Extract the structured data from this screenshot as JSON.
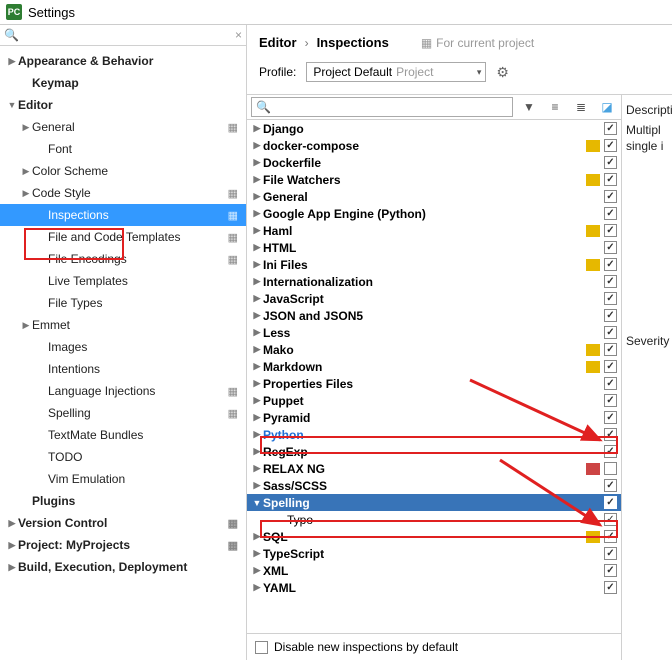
{
  "window": {
    "title": "Settings"
  },
  "search": {
    "placeholder": ""
  },
  "leftTree": {
    "items": [
      {
        "label": "Appearance & Behavior",
        "bold": true,
        "chev": "right",
        "indent": 0
      },
      {
        "label": "Keymap",
        "bold": true,
        "indent": 1
      },
      {
        "label": "Editor",
        "bold": true,
        "chev": "down",
        "indent": 0
      },
      {
        "label": "General",
        "indent": 1,
        "chev": "right",
        "copy": true
      },
      {
        "label": "Font",
        "indent": 2
      },
      {
        "label": "Color Scheme",
        "indent": 1,
        "chev": "right"
      },
      {
        "label": "Code Style",
        "indent": 1,
        "chev": "right",
        "copy": true
      },
      {
        "label": "Inspections",
        "indent": 2,
        "selected": true,
        "copy": true
      },
      {
        "label": "File and Code Templates",
        "indent": 2,
        "copy": true
      },
      {
        "label": "File Encodings",
        "indent": 2,
        "copy": true
      },
      {
        "label": "Live Templates",
        "indent": 2
      },
      {
        "label": "File Types",
        "indent": 2
      },
      {
        "label": "Emmet",
        "indent": 1,
        "chev": "right"
      },
      {
        "label": "Images",
        "indent": 2
      },
      {
        "label": "Intentions",
        "indent": 2
      },
      {
        "label": "Language Injections",
        "indent": 2,
        "copy": true
      },
      {
        "label": "Spelling",
        "indent": 2,
        "copy": true
      },
      {
        "label": "TextMate Bundles",
        "indent": 2
      },
      {
        "label": "TODO",
        "indent": 2
      },
      {
        "label": "Vim Emulation",
        "indent": 2
      },
      {
        "label": "Plugins",
        "bold": true,
        "indent": 1
      },
      {
        "label": "Version Control",
        "bold": true,
        "chev": "right",
        "indent": 0,
        "copy": true
      },
      {
        "label": "Project: MyProjects",
        "bold": true,
        "chev": "right",
        "indent": 0,
        "copy": true
      },
      {
        "label": "Build, Execution, Deployment",
        "bold": true,
        "chev": "right",
        "indent": 0
      }
    ]
  },
  "breadcrumb": {
    "a": "Editor",
    "b": "Inspections",
    "for_project": "For current project"
  },
  "profile": {
    "label": "Profile:",
    "value": "Project Default",
    "suffix": "Project"
  },
  "inspections": [
    {
      "label": "Django",
      "color": "",
      "checked": true
    },
    {
      "label": "docker-compose",
      "color": "#e6b800",
      "checked": true
    },
    {
      "label": "Dockerfile",
      "color": "",
      "checked": true
    },
    {
      "label": "File Watchers",
      "color": "#e6b800",
      "checked": true
    },
    {
      "label": "General",
      "color": "",
      "checked": true
    },
    {
      "label": "Google App Engine (Python)",
      "color": "",
      "checked": true
    },
    {
      "label": "Haml",
      "color": "#e6b800",
      "checked": true
    },
    {
      "label": "HTML",
      "color": "",
      "checked": true
    },
    {
      "label": "Ini Files",
      "color": "#e6b800",
      "checked": true
    },
    {
      "label": "Internationalization",
      "color": "",
      "checked": true
    },
    {
      "label": "JavaScript",
      "color": "",
      "checked": true
    },
    {
      "label": "JSON and JSON5",
      "color": "",
      "checked": true
    },
    {
      "label": "Less",
      "color": "",
      "checked": true
    },
    {
      "label": "Mako",
      "color": "#e6b800",
      "checked": true
    },
    {
      "label": "Markdown",
      "color": "#e6b800",
      "checked": true
    },
    {
      "label": "Properties Files",
      "color": "",
      "checked": true
    },
    {
      "label": "Puppet",
      "color": "",
      "checked": true
    },
    {
      "label": "Pyramid",
      "color": "",
      "checked": true
    },
    {
      "label": "Python",
      "color": "",
      "checked": true,
      "hl": "blue"
    },
    {
      "label": "RegExp",
      "color": "",
      "checked": true
    },
    {
      "label": "RELAX NG",
      "color": "#cc4444",
      "checked": false
    },
    {
      "label": "Sass/SCSS",
      "color": "",
      "checked": true
    },
    {
      "label": "Spelling",
      "color": "",
      "checked": true,
      "selected": true,
      "expanded": true
    },
    {
      "label": "Typo",
      "color": "",
      "checked": true,
      "child": true
    },
    {
      "label": "SQL",
      "color": "#e6b800",
      "checked": true
    },
    {
      "label": "TypeScript",
      "color": "",
      "checked": true
    },
    {
      "label": "XML",
      "color": "",
      "checked": true
    },
    {
      "label": "YAML",
      "color": "",
      "checked": true
    }
  ],
  "disable_label": "Disable new inspections by default",
  "rightPane": {
    "desc_label": "Descripti",
    "desc_text1": "Multipl",
    "desc_text2": "single i",
    "severity_label": "Severity"
  }
}
